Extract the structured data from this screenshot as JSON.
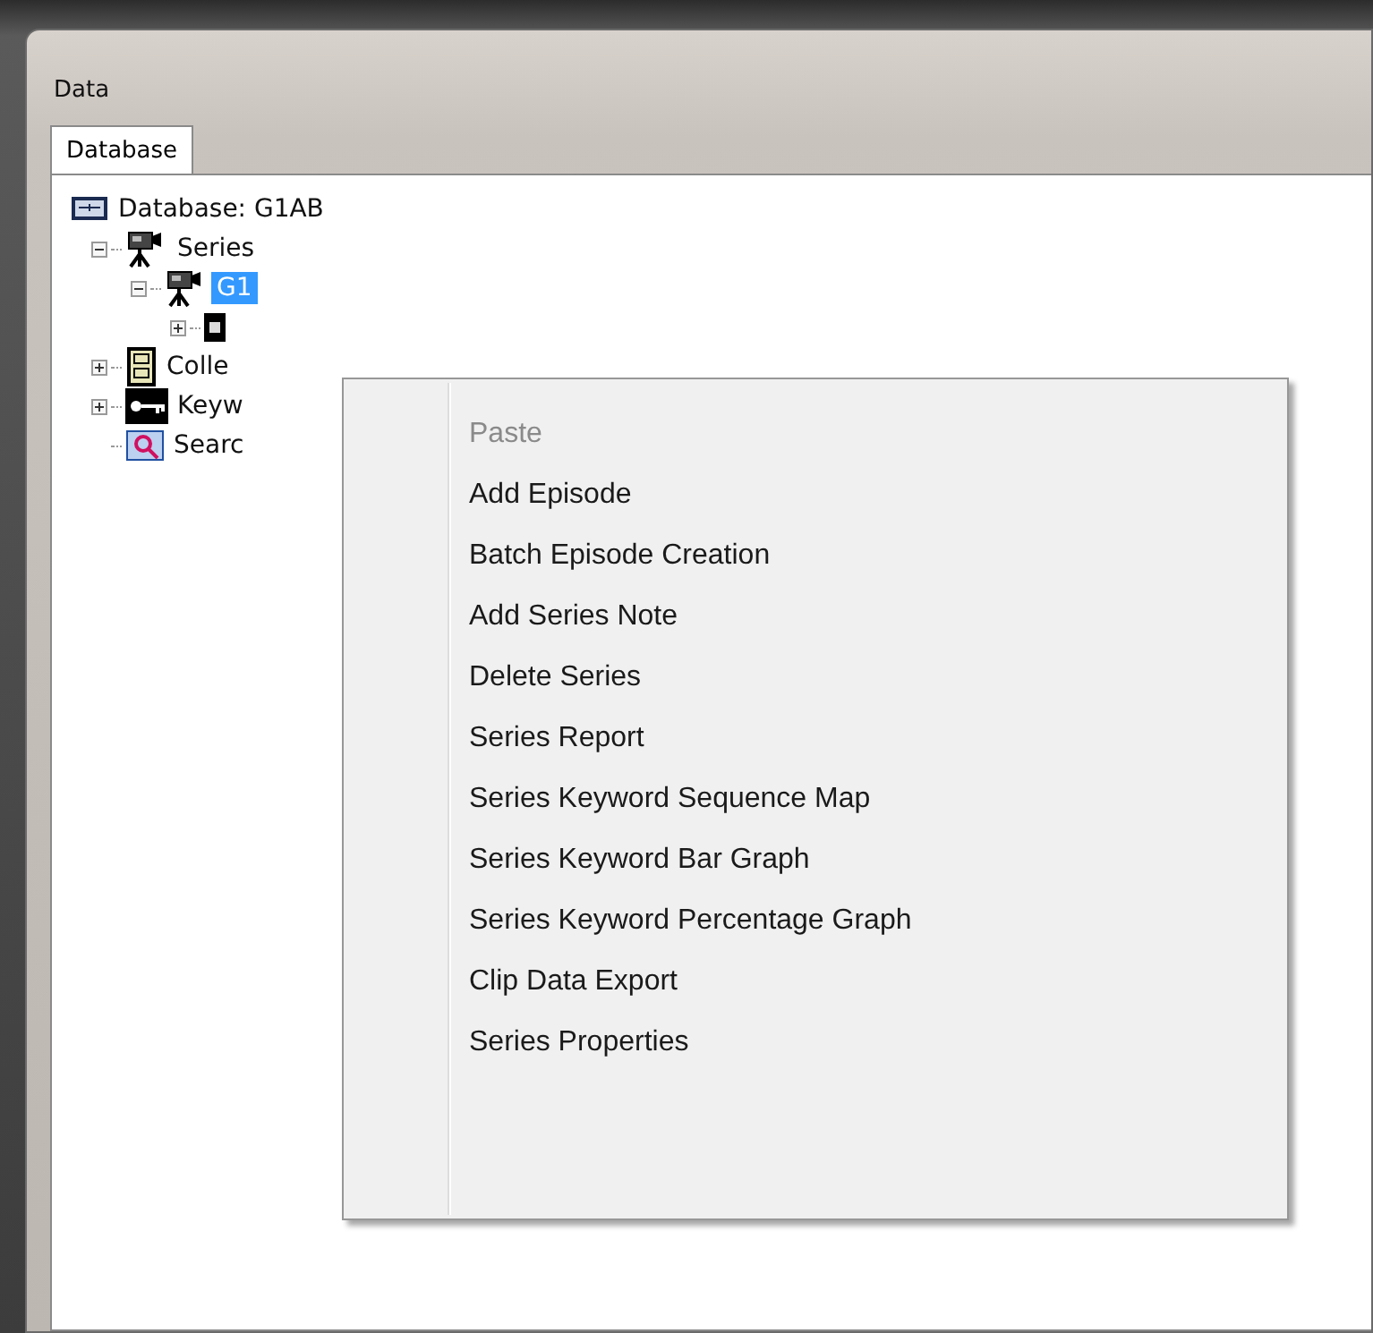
{
  "window": {
    "title": "Data"
  },
  "tabs": [
    {
      "label": "Database",
      "selected": true
    }
  ],
  "tree": {
    "label": "Database: G1AB",
    "kind": "database",
    "children": [
      {
        "label": "Series",
        "kind": "camera",
        "expanded": true,
        "children": [
          {
            "label": "G1",
            "kind": "camera",
            "expanded": true,
            "selected": true,
            "children": [
              {
                "kind": "episode",
                "expanded": false
              }
            ]
          }
        ]
      },
      {
        "label": "Colle",
        "kind": "cabinet",
        "expanded": false
      },
      {
        "label": "Keyw",
        "kind": "key",
        "expanded": false
      },
      {
        "label": "Searc",
        "kind": "search"
      }
    ]
  },
  "context_menu": {
    "items": [
      {
        "label": "Paste",
        "disabled": true
      },
      {
        "label": "Add Episode",
        "disabled": false
      },
      {
        "label": "Batch Episode Creation",
        "disabled": false
      },
      {
        "label": "Add Series Note",
        "disabled": false
      },
      {
        "label": "Delete Series",
        "disabled": false
      },
      {
        "label": "Series Report",
        "disabled": false
      },
      {
        "label": "Series Keyword Sequence Map",
        "disabled": false
      },
      {
        "label": "Series Keyword Bar Graph",
        "disabled": false
      },
      {
        "label": "Series Keyword Percentage Graph",
        "disabled": false
      },
      {
        "label": "Clip Data Export",
        "disabled": false
      },
      {
        "label": "Series Properties",
        "disabled": false
      }
    ]
  }
}
